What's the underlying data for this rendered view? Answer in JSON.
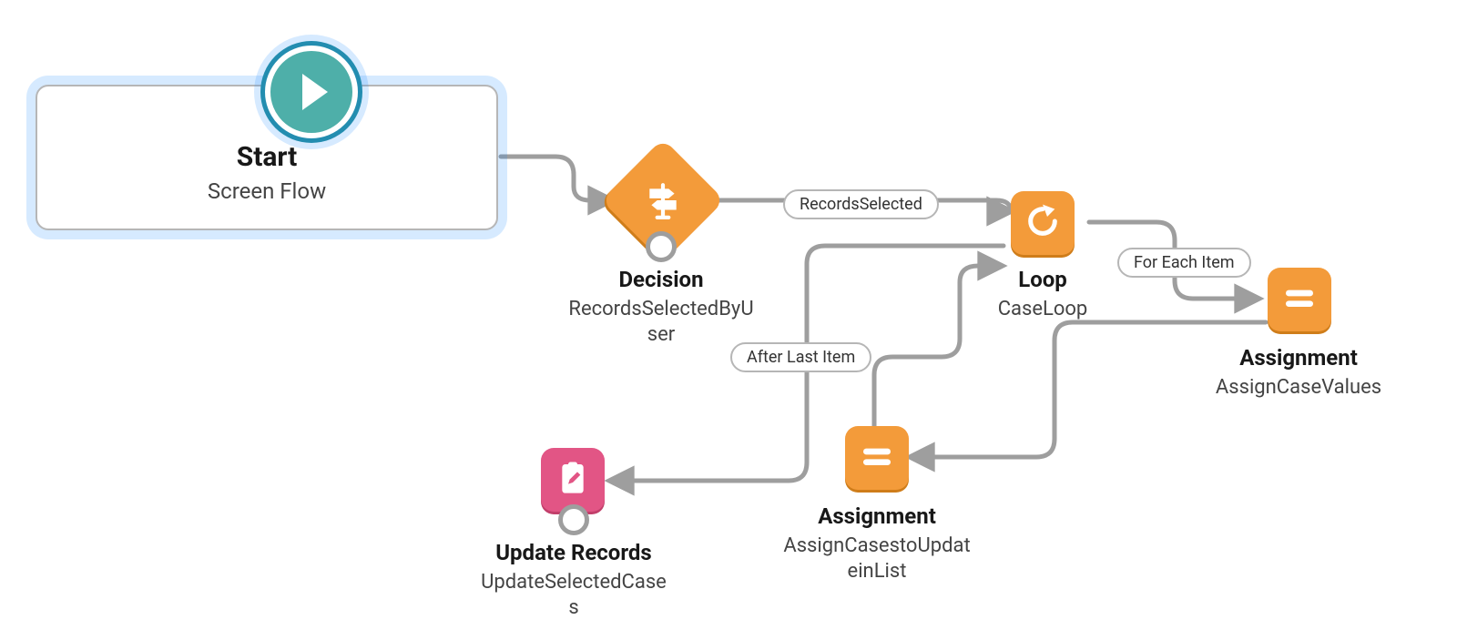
{
  "nodes": {
    "start": {
      "title": "Start",
      "subtitle": "Screen Flow"
    },
    "decision": {
      "title": "Decision",
      "subtitle": "RecordsSelectedByUser"
    },
    "loop": {
      "title": "Loop",
      "subtitle": "CaseLoop"
    },
    "assign1": {
      "title": "Assignment",
      "subtitle": "AssignCaseValues"
    },
    "assign2": {
      "title": "Assignment",
      "subtitle": "AssignCasestoUpdateinList"
    },
    "update": {
      "title": "Update Records",
      "subtitle": "UpdateSelectedCases"
    }
  },
  "edges": {
    "records_selected": "RecordsSelected",
    "for_each_item": "For Each Item",
    "after_last_item": "After Last Item"
  },
  "colors": {
    "orange": "#f39b3a",
    "pink": "#e25585",
    "teal": "#4eafa9",
    "selection": "rgba(30,140,255,0.18)",
    "connector": "#9e9e9e"
  }
}
